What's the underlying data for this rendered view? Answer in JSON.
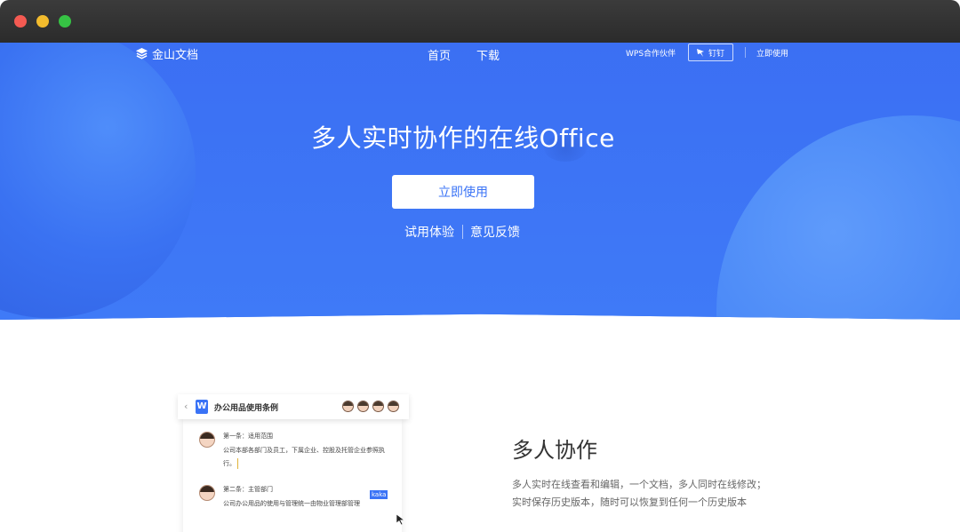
{
  "window": {
    "controls": [
      "close",
      "minimize",
      "maximize"
    ]
  },
  "nav": {
    "logo_text": "金山文档",
    "links": [
      "首页",
      "下载"
    ],
    "partner": "WPS合作伙伴",
    "dingding": "钉钉",
    "use_now": "立即使用"
  },
  "hero": {
    "title": "多人实时协作的在线Office",
    "cta": "立即使用",
    "trial": "试用体验",
    "feedback": "意见反馈"
  },
  "doc_preview": {
    "icon_letter": "W",
    "title": "办公用品使用条例",
    "comments": [
      {
        "head": "第一条：适用范围",
        "text": "公司本部各部门及员工，下属企业、控股及托管企业参照执行。"
      },
      {
        "head": "第二条：主管部门",
        "text": "公司办公用品的使用与管理统一由物业管理部管理"
      }
    ],
    "cursor_tag": "kaka"
  },
  "feature": {
    "title": "多人协作",
    "desc_line1": "多人实时在线查看和编辑，一个文档，多人同时在线修改；",
    "desc_line2": "实时保存历史版本，随时可以恢复到任何一个历史版本"
  },
  "colors": {
    "brand_blue": "#3a73f6",
    "titlebar": "#2f2f2f"
  }
}
